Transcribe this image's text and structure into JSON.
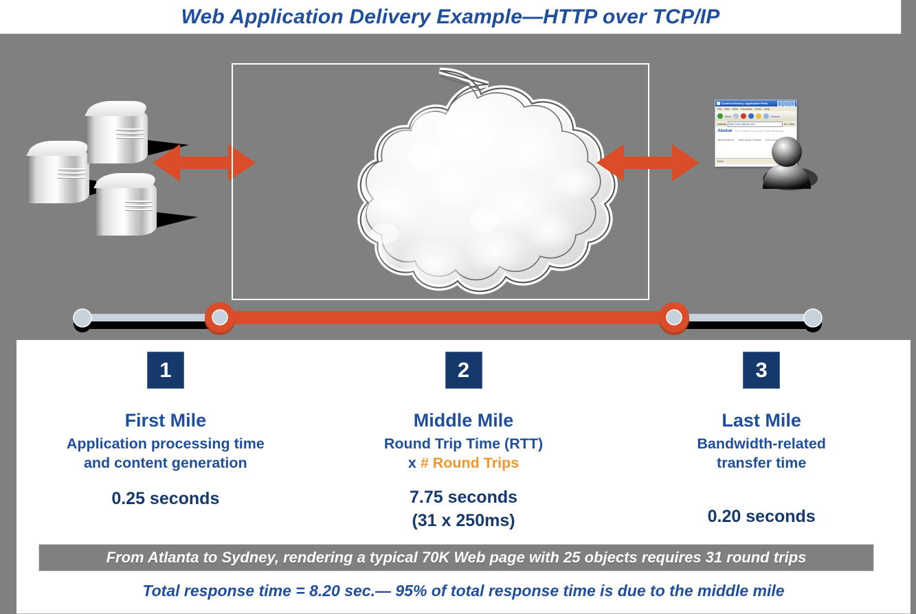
{
  "header": {
    "title": "Web Application Delivery Example—HTTP over TCP/IP"
  },
  "diagram": {
    "left_icon_name": "server-stack-icon",
    "cloud_label": "internet-cloud",
    "right_icon_name": "user-browser-icon",
    "arrow_color": "#DB4C28",
    "background_color": "#808080",
    "browser": {
      "window_title": "Content Delivery: Application Perfo",
      "menu_items": [
        "File",
        "Edit",
        "View",
        "Favorites",
        "Tools",
        "Help"
      ],
      "toolbar_back": "Back",
      "toolbar_search": "Search",
      "address_label": "Address",
      "address_value": "http://www.akamai.com/",
      "go_label": "Go",
      "links_label": "Links",
      "page_logo": "Akamai",
      "page_tagline": "The Trusted Choice for Online Business",
      "page_links": [
        "Network Metrics",
        "Sales &amp; Products",
        "Cust. Community"
      ],
      "status_text": "Done"
    }
  },
  "timeline": {
    "nodes": [
      {
        "name": "first-mile-start",
        "x_pct": 9.0,
        "style": "plain"
      },
      {
        "name": "middle-mile-start",
        "x_pct": 24.0,
        "style": "accent"
      },
      {
        "name": "middle-mile-end",
        "x_pct": 73.5,
        "style": "accent"
      },
      {
        "name": "last-mile-end",
        "x_pct": 88.7,
        "style": "plain"
      }
    ],
    "segment_colors": {
      "first_mile": "#c8d2dc",
      "middle_mile": "#DB4C28",
      "last_mile": "#c8d2dc"
    }
  },
  "columns": [
    {
      "number": "1",
      "name": "First Mile",
      "description_line1": "Application processing time",
      "description_line2": "and content generation",
      "description_accent": "",
      "value_line1": "0.25 seconds",
      "value_line2": ""
    },
    {
      "number": "2",
      "name": "Middle Mile",
      "description_line1": "Round Trip Time (RTT)",
      "description_line2": "x",
      "description_accent": "# Round Trips",
      "value_line1": "7.75 seconds",
      "value_line2": "(31 x 250ms)"
    },
    {
      "number": "3",
      "name": "Last Mile",
      "description_line1": "Bandwidth-related",
      "description_line2": "transfer time",
      "description_accent": "",
      "value_line1": "0.20 seconds",
      "value_line2": ""
    }
  ],
  "footer": {
    "note": "From Atlanta to Sydney, rendering a typical 70K Web page with 25 objects requires 31 round trips",
    "total": "Total response time = 8.20 sec.— 95% of total response time is due to the middle mile"
  },
  "colors": {
    "title_blue": "#1F4E9C",
    "badge_navy": "#16396C",
    "accent_orange": "#F0962E",
    "arrow_orange": "#DB4C28",
    "gray_bg": "#808080"
  }
}
